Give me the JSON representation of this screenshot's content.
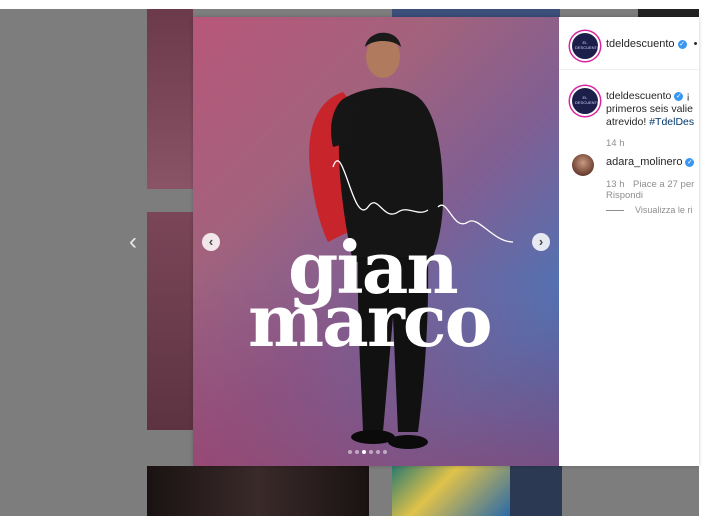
{
  "colors": {
    "accent_blue": "#3897f0",
    "hashtag": "#00376b",
    "muted": "#8e8e8e"
  },
  "navigation": {
    "prev_icon": "chevron-left-icon"
  },
  "post": {
    "photo": {
      "line1": "gian",
      "line2": "marco",
      "prev_slide_icon": "chevron-left-icon",
      "next_slide_icon": "chevron-right-icon",
      "slide_count": 6,
      "active_slide": 3
    },
    "header": {
      "avatar_text": "EL DESCUENTO",
      "username": "tdeldescuento",
      "verified_mark": "✓",
      "more": "•"
    },
    "caption": {
      "username": "tdeldescuento",
      "line1_text": "¡",
      "line2": "primeros seis valie",
      "line3_text": "atrevido! ",
      "hashtag": "#TdelDes",
      "time": "14 h"
    },
    "comment": {
      "username": "adara_molinero",
      "time": "13 h",
      "likes": "Piace a 27 per",
      "reply": "Rispondi",
      "view_replies": "Visualizza le ri"
    }
  }
}
